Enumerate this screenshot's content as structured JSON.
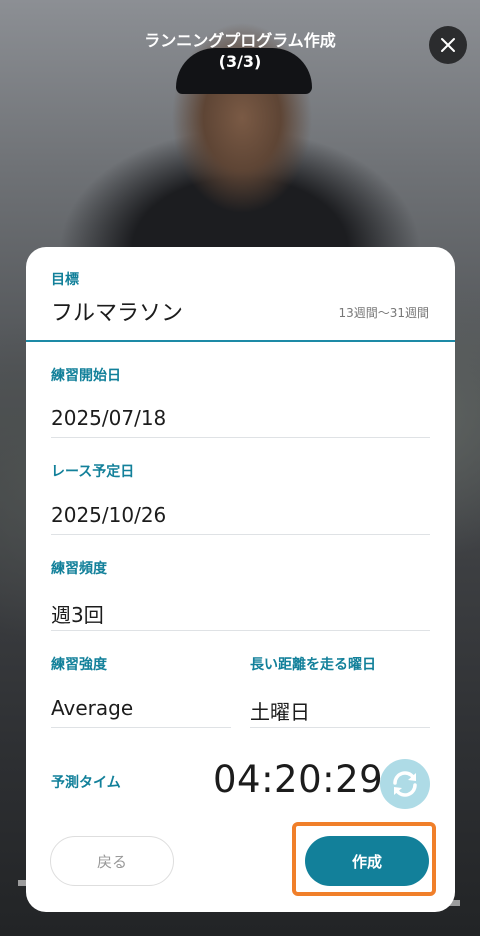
{
  "header": {
    "title_line1": "ランニングプログラム作成",
    "title_line2": "(3/3)",
    "close_icon": "close-icon"
  },
  "goal": {
    "label": "目標",
    "value": "フルマラソン",
    "range": "13週間〜31週間"
  },
  "fields": {
    "start_date": {
      "label": "練習開始日",
      "value": "2025/07/18"
    },
    "race_date": {
      "label": "レース予定日",
      "value": "2025/10/26"
    },
    "frequency": {
      "label": "練習頻度",
      "value": "週3回"
    },
    "intensity": {
      "label": "練習強度",
      "value": "Average"
    },
    "long_run_day": {
      "label": "長い距離を走る曜日",
      "value": "土曜日"
    }
  },
  "predicted_time": {
    "label": "予測タイム",
    "value": "04:20:29",
    "refresh_icon": "refresh-icon"
  },
  "buttons": {
    "back": "戻る",
    "create": "作成"
  },
  "colors": {
    "accent": "#12809a",
    "highlight": "#f07f2a",
    "refresh_bg": "#aedbe6"
  }
}
